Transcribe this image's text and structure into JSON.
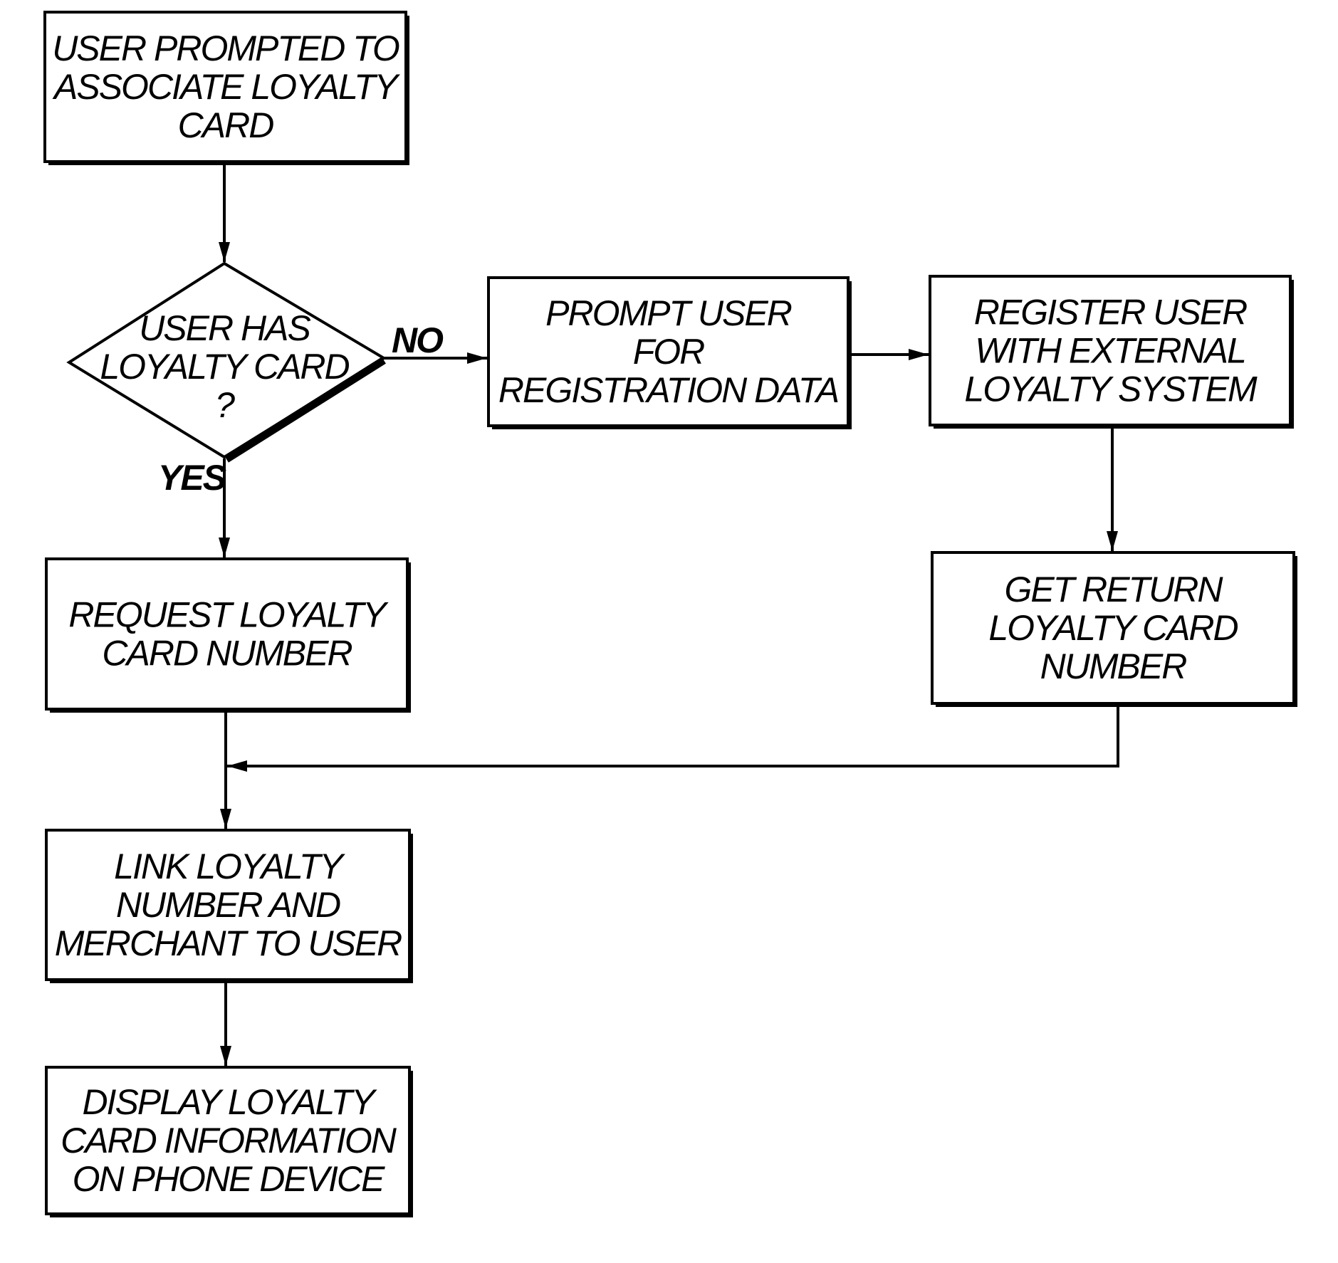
{
  "nodes": {
    "start": {
      "lines": [
        "USER PROMPTED TO",
        "ASSOCIATE LOYALTY",
        "CARD"
      ]
    },
    "decision": {
      "lines": [
        "USER HAS",
        "LOYALTY CARD",
        "?"
      ]
    },
    "prompt": {
      "lines": [
        "PROMPT USER",
        "FOR",
        "REGISTRATION DATA"
      ]
    },
    "register": {
      "lines": [
        "REGISTER USER",
        "WITH EXTERNAL",
        "LOYALTY SYSTEM"
      ]
    },
    "request": {
      "lines": [
        "REQUEST LOYALTY",
        "CARD NUMBER"
      ]
    },
    "getreturn": {
      "lines": [
        "GET RETURN",
        "LOYALTY CARD",
        "NUMBER"
      ]
    },
    "link": {
      "lines": [
        "LINK LOYALTY",
        "NUMBER AND",
        "MERCHANT TO USER"
      ]
    },
    "display": {
      "lines": [
        "DISPLAY LOYALTY",
        "CARD INFORMATION",
        "ON PHONE DEVICE"
      ]
    }
  },
  "edges": {
    "no_label": "NO",
    "yes_label": "YES"
  }
}
